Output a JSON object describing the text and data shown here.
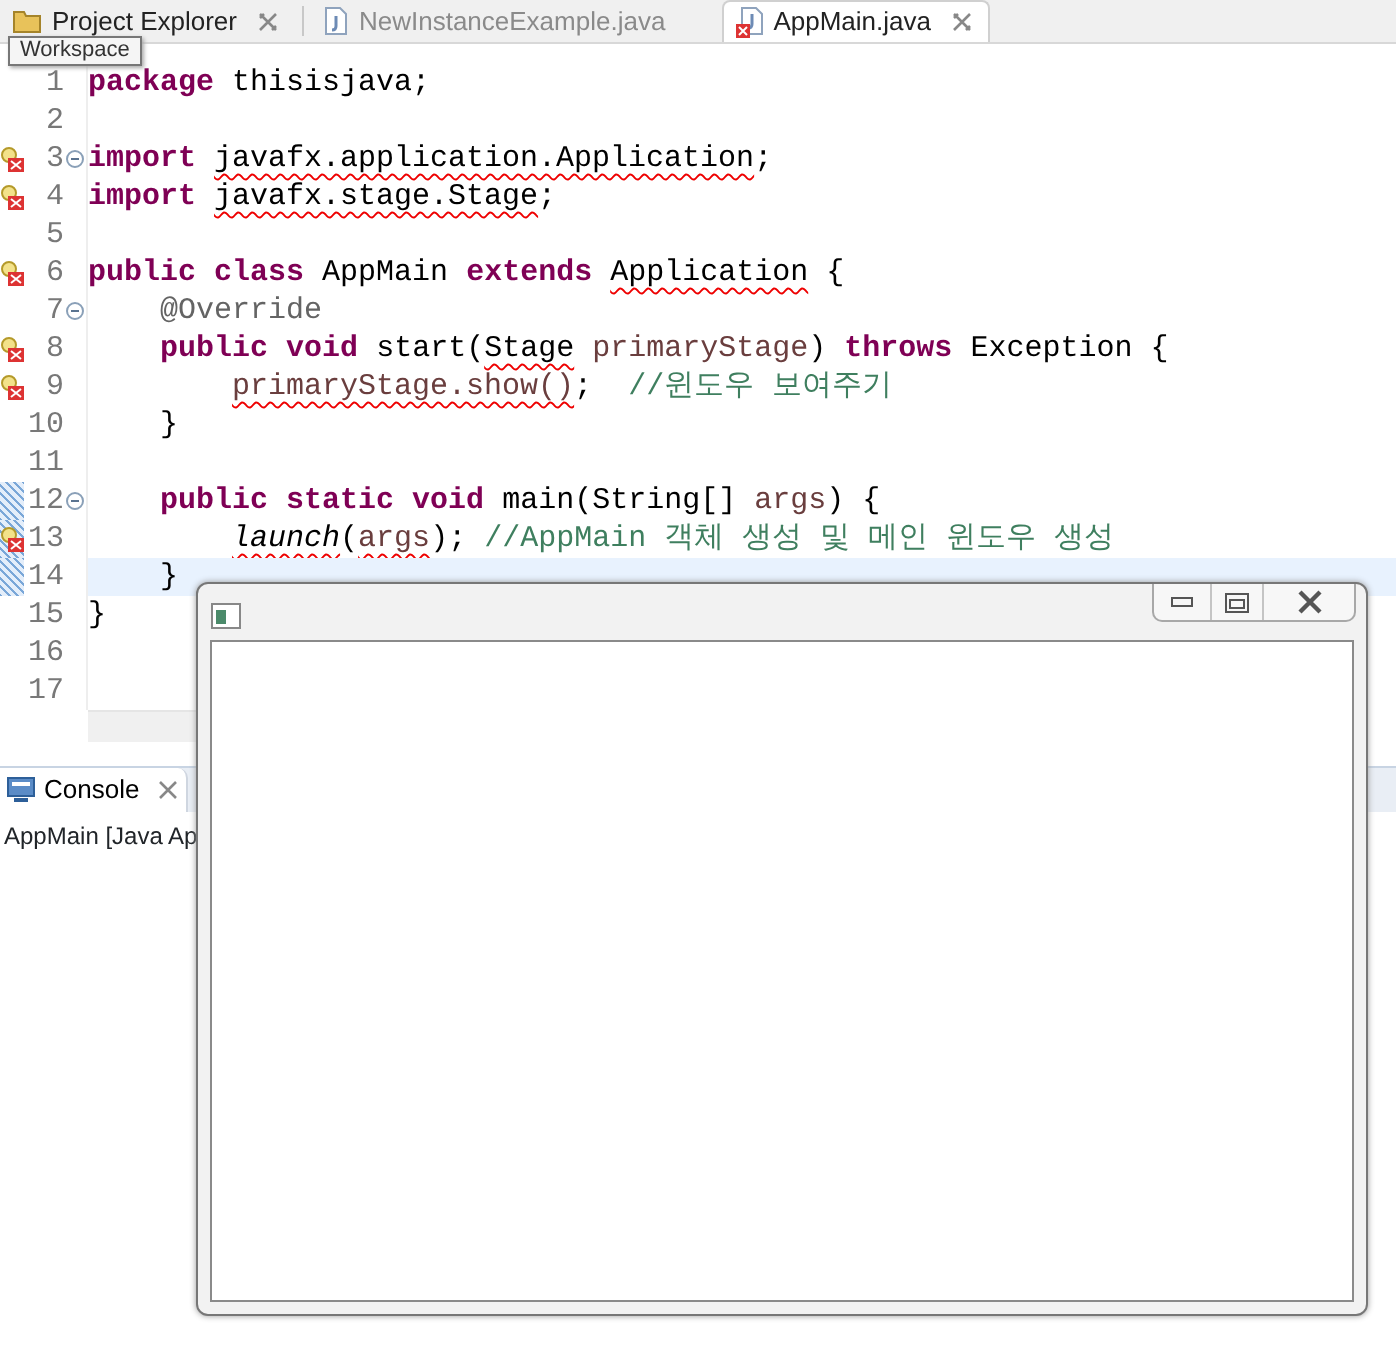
{
  "tabs": [
    {
      "label": "Project Explorer",
      "kind": "view",
      "selected": false,
      "closable": true
    },
    {
      "label": "NewInstanceExample.java",
      "kind": "java",
      "selected": false,
      "closable": false
    },
    {
      "label": "AppMain.java",
      "kind": "java-error",
      "selected": true,
      "closable": true
    }
  ],
  "tooltip": "Workspace",
  "lines": [
    {
      "number": "1",
      "current": false,
      "tokens": [
        {
          "text": "package",
          "kind": "keyword",
          "squiggle": false
        },
        {
          "text": " thisisjava;",
          "kind": "plain",
          "squiggle": false
        }
      ]
    },
    {
      "number": "2",
      "current": false
    },
    {
      "number": "3",
      "current": false,
      "markers": [
        {
          "kind": "error"
        },
        {
          "kind": "fold"
        }
      ],
      "tokens": [
        {
          "text": "import ",
          "kind": "keyword",
          "squiggle": false
        },
        {
          "text": "javafx.application.Application",
          "kind": "plain",
          "squiggle": true
        },
        {
          "text": ";",
          "kind": "plain",
          "squiggle": false
        }
      ]
    },
    {
      "number": "4",
      "current": false,
      "markers": [
        {
          "kind": "error"
        }
      ],
      "tokens": [
        {
          "text": "import ",
          "kind": "keyword",
          "squiggle": false
        },
        {
          "text": "javafx.stage.Stage",
          "kind": "plain",
          "squiggle": true
        },
        {
          "text": ";",
          "kind": "plain",
          "squiggle": false
        }
      ]
    },
    {
      "number": "5",
      "current": false
    },
    {
      "number": "6",
      "current": false,
      "markers": [
        {
          "kind": "error"
        }
      ],
      "tokens": [
        {
          "text": "public class",
          "kind": "keyword",
          "squiggle": false
        },
        {
          "text": " AppMain ",
          "kind": "plain",
          "squiggle": false
        },
        {
          "text": "extends ",
          "kind": "keyword",
          "squiggle": false
        },
        {
          "text": "Application",
          "kind": "plain",
          "squiggle": true
        },
        {
          "text": " {",
          "kind": "plain",
          "squiggle": false
        }
      ]
    },
    {
      "number": "7",
      "current": false,
      "markers": [
        {
          "kind": "fold"
        }
      ],
      "tokens": [
        {
          "text": "    @Override",
          "kind": "annotation",
          "squiggle": false
        }
      ]
    },
    {
      "number": "8",
      "current": false,
      "markers": [
        {
          "kind": "error"
        }
      ],
      "tokens": [
        {
          "text": "    public void",
          "kind": "keyword",
          "squiggle": false
        },
        {
          "text": " start(",
          "kind": "plain",
          "squiggle": false
        },
        {
          "text": "Stage",
          "kind": "plain",
          "squiggle": true
        },
        {
          "text": " primaryStage",
          "kind": "param",
          "squiggle": false
        },
        {
          "text": ") ",
          "kind": "plain",
          "squiggle": false
        },
        {
          "text": "throws",
          "kind": "keyword",
          "squiggle": false
        },
        {
          "text": " Exception {",
          "kind": "plain",
          "squiggle": false
        }
      ]
    },
    {
      "number": "9",
      "current": false,
      "markers": [
        {
          "kind": "error"
        }
      ],
      "tokens": [
        {
          "text": "        primaryStage.show()",
          "kind": "param",
          "squiggle": true
        },
        {
          "text": ";  ",
          "kind": "plain",
          "squiggle": false
        },
        {
          "text": "//윈도우 보여주기",
          "kind": "comment",
          "squiggle": false
        }
      ]
    },
    {
      "number": "10",
      "current": false,
      "tokens": [
        {
          "text": "    }",
          "kind": "plain",
          "squiggle": false
        }
      ]
    },
    {
      "number": "11",
      "current": false
    },
    {
      "number": "12",
      "current": false,
      "markers": [
        {
          "kind": "changed"
        },
        {
          "kind": "fold"
        }
      ],
      "tokens": [
        {
          "text": "    public static void",
          "kind": "keyword",
          "squiggle": false
        },
        {
          "text": " main(String[] ",
          "kind": "plain",
          "squiggle": false
        },
        {
          "text": "args",
          "kind": "param",
          "squiggle": false
        },
        {
          "text": ") {",
          "kind": "plain",
          "squiggle": false
        }
      ]
    },
    {
      "number": "13",
      "current": false,
      "markers": [
        {
          "kind": "changed"
        },
        {
          "kind": "error"
        }
      ],
      "tokens": [
        {
          "text": "        launch",
          "kind": "static",
          "squiggle": true
        },
        {
          "text": "(",
          "kind": "plain",
          "squiggle": false
        },
        {
          "text": "args",
          "kind": "param",
          "squiggle": true
        },
        {
          "text": "); ",
          "kind": "plain",
          "squiggle": false
        },
        {
          "text": "//AppMain 객체 생성 및 메인 윈도우 생성",
          "kind": "comment",
          "squiggle": false
        }
      ]
    },
    {
      "number": "14",
      "current": true,
      "markers": [
        {
          "kind": "changed"
        }
      ],
      "tokens": [
        {
          "text": "    }",
          "kind": "plain",
          "squiggle": false
        }
      ]
    },
    {
      "number": "15",
      "current": false,
      "tokens": [
        {
          "text": "}",
          "kind": "plain",
          "squiggle": false
        }
      ]
    },
    {
      "number": "16",
      "current": false
    },
    {
      "number": "17",
      "current": false
    }
  ],
  "console": {
    "tab": {
      "label": "Console",
      "selected": true
    },
    "text": "AppMain [Java Ap"
  }
}
